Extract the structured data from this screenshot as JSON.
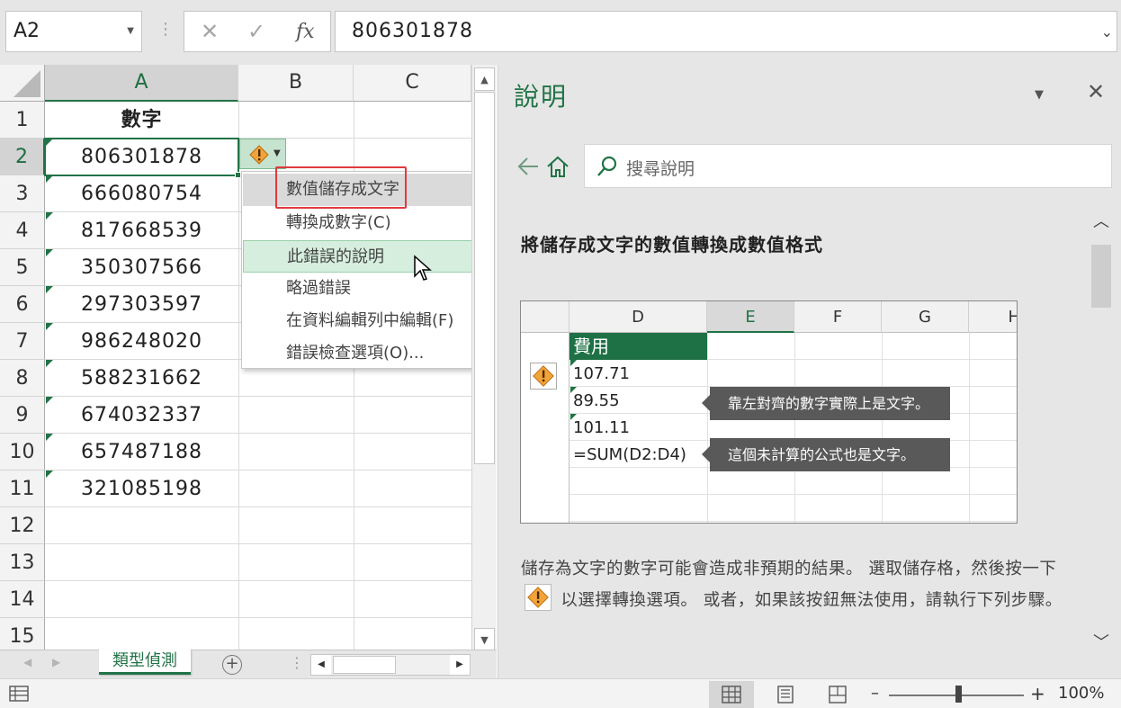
{
  "formula_bar": {
    "name_box": "A2",
    "cancel": "✕",
    "enter": "✓",
    "fx": "fx",
    "value": "806301878"
  },
  "grid": {
    "columns": [
      "A",
      "B",
      "C"
    ],
    "selected_column": "A",
    "selected_row": "2",
    "rows": [
      "1",
      "2",
      "3",
      "4",
      "5",
      "6",
      "7",
      "8",
      "9",
      "10",
      "11",
      "12",
      "13",
      "14",
      "15"
    ],
    "col_a": [
      "數字",
      "806301878",
      "666080754",
      "817668539",
      "350307566",
      "297303597",
      "986248020",
      "588231662",
      "674032337",
      "657487188",
      "321085198"
    ]
  },
  "error_menu": {
    "items": [
      "數值儲存成文字",
      "轉換成數字(C)",
      "此錯誤的說明",
      "略過錯誤",
      "在資料編輯列中編輯(F)",
      "錯誤檢查選項(O)..."
    ],
    "highlighted": "數值儲存成文字",
    "hovered": "此錯誤的說明"
  },
  "sheet_tabs": {
    "active": "類型偵測",
    "add": "+"
  },
  "status_bar": {
    "zoom_minus": "–",
    "zoom_plus": "+",
    "zoom": "100%"
  },
  "help_pane": {
    "title": "說明",
    "close": "✕",
    "search_placeholder": "搜尋說明",
    "heading": "將儲存成文字的數值轉換成數值格式",
    "paragraph_part1": "儲存為文字的數字可能會造成非預期的結果。 選取儲存格，然後按一下",
    "paragraph_part2": "以選擇轉換選項。 或者，如果該按鈕無法使用，請執行下列步驟。",
    "example": {
      "columns": [
        "D",
        "E",
        "F",
        "G",
        "H"
      ],
      "header_cell": "費用",
      "cells": [
        "107.71",
        "89.55",
        "101.11",
        "=SUM(D2:D4)"
      ],
      "callout1": "靠左對齊的數字實際上是文字。",
      "callout2": "這個未計算的公式也是文字。"
    }
  },
  "colors": {
    "excel_green": "#217346",
    "error_highlight_red": "#e0393e",
    "warning_orange": "#f2a33a"
  }
}
